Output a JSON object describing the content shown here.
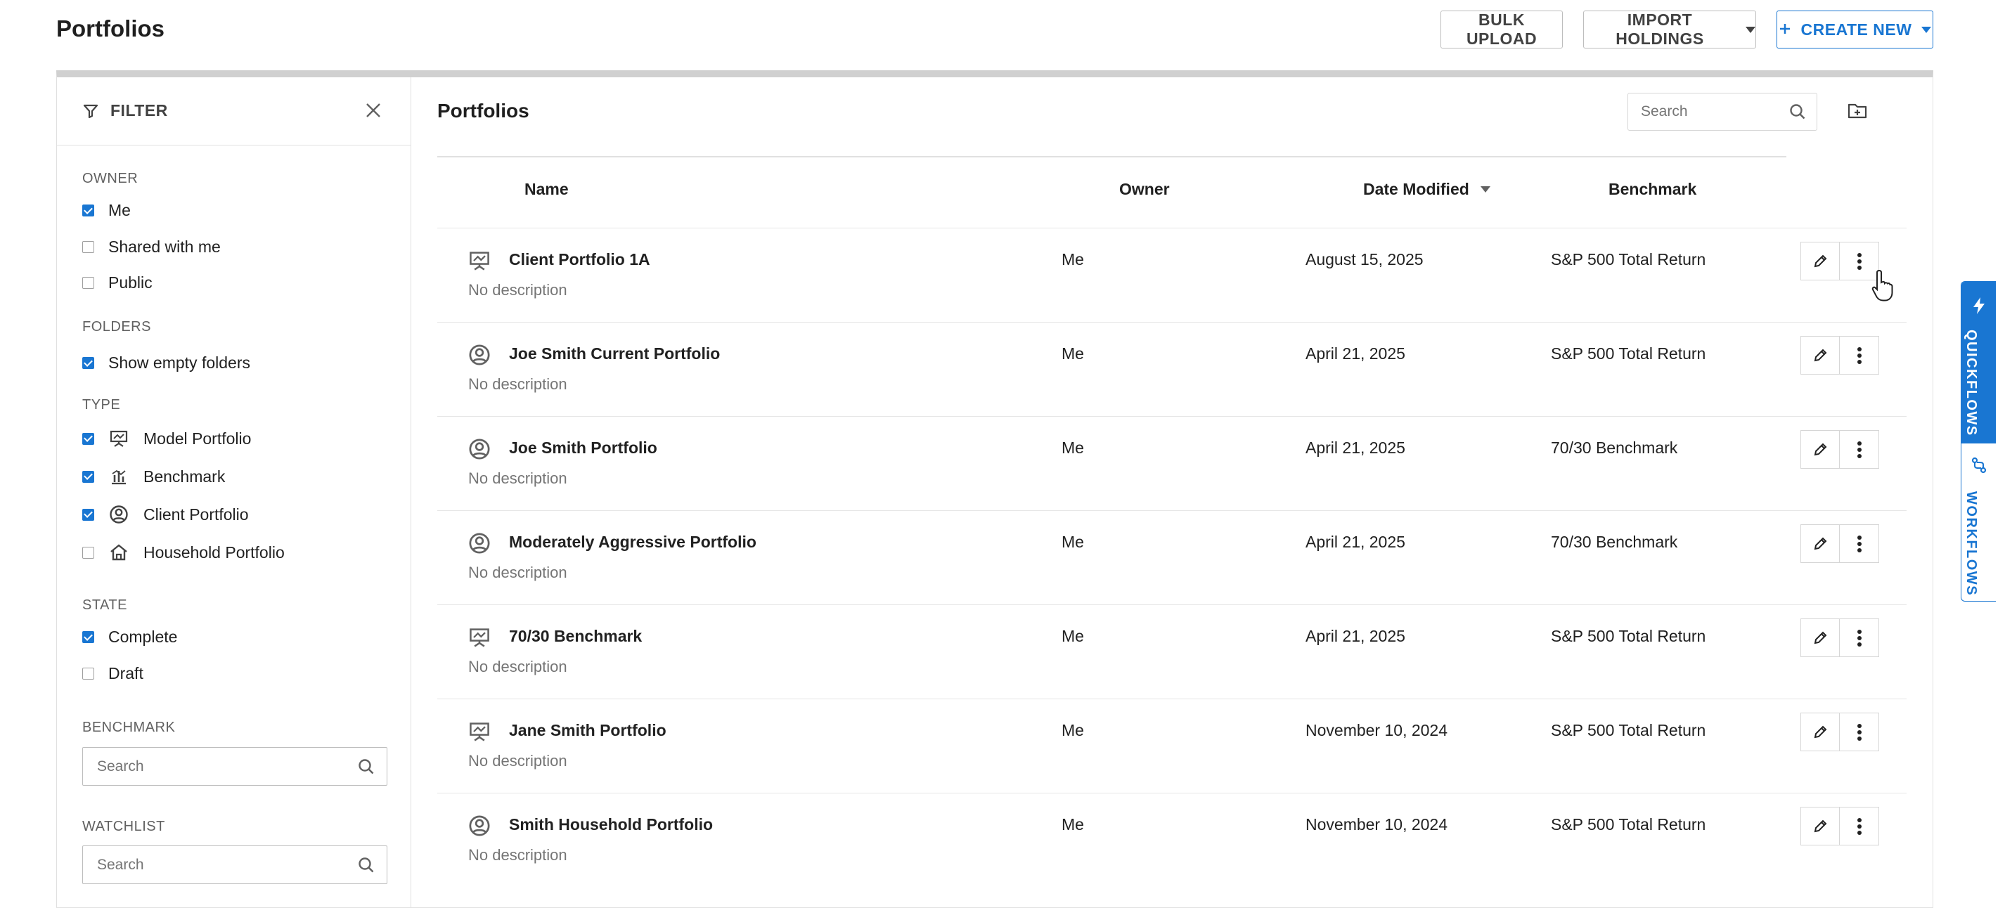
{
  "header": {
    "title": "Portfolios",
    "bulk_upload_label": "BULK UPLOAD",
    "import_holdings_label": "IMPORT HOLDINGS",
    "create_new_label": "CREATE NEW",
    "create_new_icon": "plus-icon"
  },
  "filter": {
    "title": "FILTER",
    "owner": {
      "label": "OWNER",
      "options": [
        {
          "label": "Me",
          "checked": true
        },
        {
          "label": "Shared with me",
          "checked": false
        },
        {
          "label": "Public",
          "checked": false
        }
      ]
    },
    "folders": {
      "label": "FOLDERS",
      "options": [
        {
          "label": "Show empty folders",
          "checked": true
        }
      ]
    },
    "type": {
      "label": "TYPE",
      "options": [
        {
          "label": "Model Portfolio",
          "checked": true,
          "icon": "easel-icon"
        },
        {
          "label": "Benchmark",
          "checked": true,
          "icon": "benchmark-chart-icon"
        },
        {
          "label": "Client Portfolio",
          "checked": true,
          "icon": "user-circle-icon"
        },
        {
          "label": "Household Portfolio",
          "checked": false,
          "icon": "house-icon"
        }
      ]
    },
    "state": {
      "label": "STATE",
      "options": [
        {
          "label": "Complete",
          "checked": true
        },
        {
          "label": "Draft",
          "checked": false
        }
      ]
    },
    "benchmark": {
      "label": "BENCHMARK",
      "placeholder": "Search"
    },
    "watchlist": {
      "label": "WATCHLIST",
      "placeholder": "Search"
    }
  },
  "list": {
    "title": "Portfolios",
    "search_placeholder": "Search",
    "columns": {
      "name": "Name",
      "owner": "Owner",
      "date": "Date Modified",
      "benchmark": "Benchmark"
    },
    "rows": [
      {
        "name": "Client Portfolio 1A",
        "description": "No description",
        "owner": "Me",
        "date": "August 15, 2025",
        "benchmark": "S&P 500 Total Return",
        "icon": "easel-icon"
      },
      {
        "name": "Joe Smith Current Portfolio",
        "description": "No description",
        "owner": "Me",
        "date": "April 21, 2025",
        "benchmark": "S&P 500 Total Return",
        "icon": "user-circle-icon"
      },
      {
        "name": "Joe Smith Portfolio",
        "description": "No description",
        "owner": "Me",
        "date": "April 21, 2025",
        "benchmark": "70/30 Benchmark",
        "icon": "user-circle-icon"
      },
      {
        "name": "Moderately Aggressive Portfolio",
        "description": "No description",
        "owner": "Me",
        "date": "April 21, 2025",
        "benchmark": "70/30 Benchmark",
        "icon": "user-circle-icon"
      },
      {
        "name": "70/30 Benchmark",
        "description": "No description",
        "owner": "Me",
        "date": "April 21, 2025",
        "benchmark": "S&P 500 Total Return",
        "icon": "easel-icon"
      },
      {
        "name": "Jane Smith Portfolio",
        "description": "No description",
        "owner": "Me",
        "date": "November 10, 2024",
        "benchmark": "S&P 500 Total Return",
        "icon": "easel-icon"
      },
      {
        "name": "Smith Household Portfolio",
        "description": "No description",
        "owner": "Me",
        "date": "November 10, 2024",
        "benchmark": "S&P 500 Total Return",
        "icon": "user-circle-icon"
      }
    ]
  },
  "sidetabs": {
    "quickflows": "QUICKFLOWS",
    "workflows": "WORKFLOWS"
  },
  "colors": {
    "accent": "#1976d2",
    "muted_text": "#757575",
    "border": "#e0e0e0"
  }
}
